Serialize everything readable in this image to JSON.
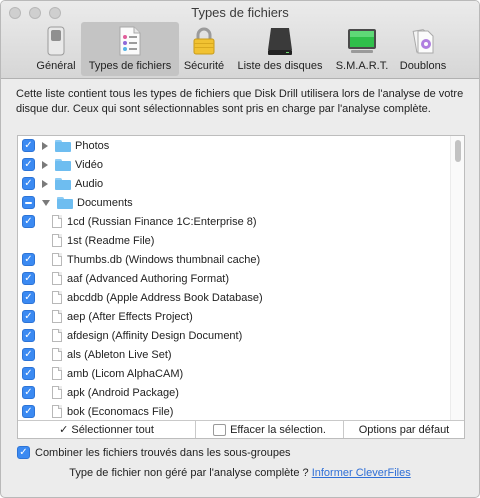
{
  "window": {
    "title": "Types de fichiers"
  },
  "toolbar": {
    "items": [
      {
        "label": "Général",
        "icon": "general-switch-icon"
      },
      {
        "label": "Types de fichiers",
        "icon": "file-types-icon"
      },
      {
        "label": "Sécurité",
        "icon": "padlock-icon"
      },
      {
        "label": "Liste des disques",
        "icon": "hard-disk-icon"
      },
      {
        "label": "S.M.A.R.T.",
        "icon": "smart-monitor-icon"
      },
      {
        "label": "Doublons",
        "icon": "duplicates-icon"
      }
    ],
    "active_index": 1
  },
  "description": "Cette liste contient tous les types de fichiers que Disk Drill utilisera lors de l'analyse de votre disque dur. Ceux qui sont sélectionnables sont pris en charge par l'analyse complète.",
  "list": {
    "rows": [
      {
        "kind": "folder",
        "checked": "on",
        "expanded": false,
        "label": "Photos"
      },
      {
        "kind": "folder",
        "checked": "on",
        "expanded": false,
        "label": "Vidéo"
      },
      {
        "kind": "folder",
        "checked": "on",
        "expanded": false,
        "label": "Audio"
      },
      {
        "kind": "folder",
        "checked": "mixed",
        "expanded": true,
        "label": "Documents"
      },
      {
        "kind": "file",
        "checked": "on",
        "label": "1cd  (Russian Finance 1C:Enterprise 8)"
      },
      {
        "kind": "file",
        "checked": "off",
        "label": "1st  (Readme File)"
      },
      {
        "kind": "file",
        "checked": "on",
        "label": "Thumbs.db  (Windows thumbnail cache)"
      },
      {
        "kind": "file",
        "checked": "on",
        "label": "aaf  (Advanced Authoring Format)"
      },
      {
        "kind": "file",
        "checked": "on",
        "label": "abcddb  (Apple Address Book Database)"
      },
      {
        "kind": "file",
        "checked": "on",
        "label": "aep  (After Effects Project)"
      },
      {
        "kind": "file",
        "checked": "on",
        "label": "afdesign  (Affinity Design Document)"
      },
      {
        "kind": "file",
        "checked": "on",
        "label": "als  (Ableton Live Set)"
      },
      {
        "kind": "file",
        "checked": "on",
        "label": "amb  (Licom AlphaCAM)"
      },
      {
        "kind": "file",
        "checked": "on",
        "label": "apk  (Android Package)"
      },
      {
        "kind": "file",
        "checked": "on",
        "label": "bok  (Economacs File)"
      }
    ],
    "footer": {
      "select_all": "✓ Sélectionner tout",
      "clear_selection": "Effacer la sélection.",
      "defaults": "Options par défaut"
    }
  },
  "combine": {
    "checked": true,
    "label": "Combiner les fichiers trouvés dans les sous-groupes"
  },
  "bottom": {
    "question": "Type de fichier non géré par l'analyse complète ?",
    "link": "Informer CleverFiles"
  }
}
